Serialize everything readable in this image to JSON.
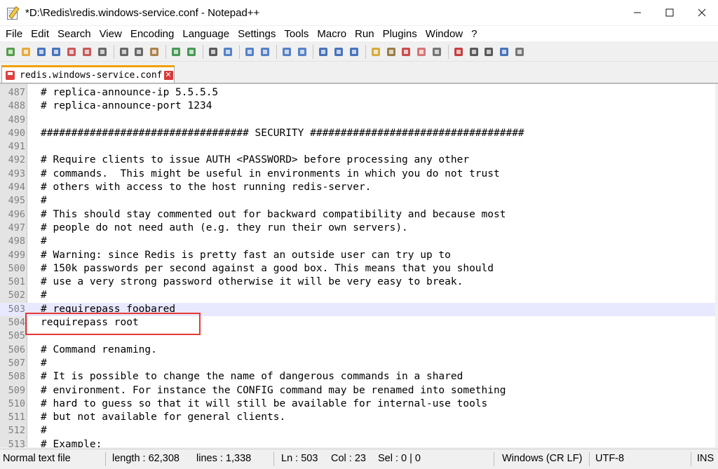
{
  "window": {
    "title": "*D:\\Redis\\redis.windows-service.conf - Notepad++",
    "minimize": "—",
    "maximize": "☐",
    "close": "✕"
  },
  "menu": [
    "File",
    "Edit",
    "Search",
    "View",
    "Encoding",
    "Language",
    "Settings",
    "Tools",
    "Macro",
    "Run",
    "Plugins",
    "Window",
    "?"
  ],
  "toolbar_icons": [
    "new-file-icon",
    "open-file-icon",
    "save-icon",
    "save-all-icon",
    "close-icon",
    "close-all-icon",
    "print-icon",
    "sep",
    "cut-icon",
    "copy-icon",
    "paste-icon",
    "sep",
    "undo-icon",
    "redo-icon",
    "sep",
    "find-icon",
    "replace-icon",
    "sep",
    "zoom-in-icon",
    "zoom-out-icon",
    "sep",
    "sync-vertical-icon",
    "sync-horizontal-icon",
    "sep",
    "word-wrap-icon",
    "show-all-chars-icon",
    "indent-guide-icon",
    "sep",
    "user-lang-icon",
    "doc-map-icon",
    "function-list-icon",
    "folder-workspace-icon",
    "monitoring-icon",
    "sep",
    "record-macro-icon",
    "stop-macro-icon",
    "play-macro-icon",
    "run-macro-multiple-icon",
    "save-macro-icon"
  ],
  "tab": {
    "label": "redis.windows-service.conf",
    "close": "✕"
  },
  "editor": {
    "lines": [
      {
        "n": "487",
        "text": "# replica-announce-ip 5.5.5.5"
      },
      {
        "n": "488",
        "text": "# replica-announce-port 1234"
      },
      {
        "n": "489",
        "text": ""
      },
      {
        "n": "490",
        "text": "################################## SECURITY ###################################"
      },
      {
        "n": "491",
        "text": ""
      },
      {
        "n": "492",
        "text": "# Require clients to issue AUTH <PASSWORD> before processing any other"
      },
      {
        "n": "493",
        "text": "# commands.  This might be useful in environments in which you do not trust"
      },
      {
        "n": "494",
        "text": "# others with access to the host running redis-server."
      },
      {
        "n": "495",
        "text": "#"
      },
      {
        "n": "496",
        "text": "# This should stay commented out for backward compatibility and because most"
      },
      {
        "n": "497",
        "text": "# people do not need auth (e.g. they run their own servers)."
      },
      {
        "n": "498",
        "text": "#"
      },
      {
        "n": "499",
        "text": "# Warning: since Redis is pretty fast an outside user can try up to"
      },
      {
        "n": "500",
        "text": "# 150k passwords per second against a good box. This means that you should"
      },
      {
        "n": "501",
        "text": "# use a very strong password otherwise it will be very easy to break."
      },
      {
        "n": "502",
        "text": "#"
      },
      {
        "n": "503",
        "text": "# requirepass foobared",
        "current": true
      },
      {
        "n": "504",
        "text": "requirepass root"
      },
      {
        "n": "505",
        "text": ""
      },
      {
        "n": "506",
        "text": "# Command renaming."
      },
      {
        "n": "507",
        "text": "#"
      },
      {
        "n": "508",
        "text": "# It is possible to change the name of dangerous commands in a shared"
      },
      {
        "n": "509",
        "text": "# environment. For instance the CONFIG command may be renamed into something"
      },
      {
        "n": "510",
        "text": "# hard to guess so that it will still be available for internal-use tools"
      },
      {
        "n": "511",
        "text": "# but not available for general clients."
      },
      {
        "n": "512",
        "text": "#"
      },
      {
        "n": "513",
        "text": "# Example:"
      }
    ]
  },
  "status": {
    "filetype": "Normal text file",
    "length": "length : 62,308",
    "lines": "lines : 1,338",
    "ln": "Ln : 503",
    "col": "Col : 23",
    "sel": "Sel : 0 | 0",
    "eol": "Windows (CR LF)",
    "encoding": "UTF-8",
    "mode": "INS"
  }
}
